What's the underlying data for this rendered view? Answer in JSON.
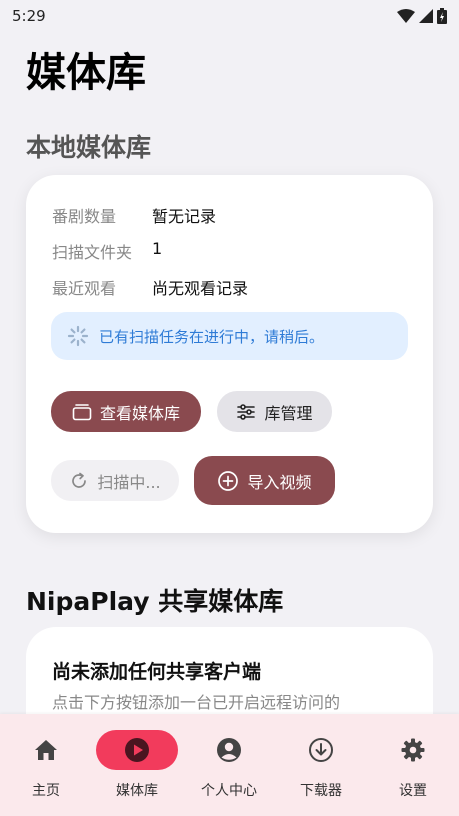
{
  "status_bar": {
    "time": "5:29"
  },
  "page_title": "媒体库",
  "local_section": {
    "title": "本地媒体库",
    "rows": [
      {
        "label": "番剧数量",
        "value": "暂无记录"
      },
      {
        "label": "扫描文件夹",
        "value": "1"
      },
      {
        "label": "最近观看",
        "value": "尚无观看记录"
      }
    ],
    "alert_text": "已有扫描任务在进行中，请稍后。",
    "buttons": {
      "view_library": "查看媒体库",
      "manage_library": "库管理",
      "scanning": "扫描中...",
      "import_video": "导入视频"
    }
  },
  "shared_section": {
    "title": "NipaPlay 共享媒体库",
    "empty_title": "尚未添加任何共享客户端",
    "empty_desc": "点击下方按钮添加一台已开启远程访问的"
  },
  "bottom_nav": {
    "items": [
      {
        "label": "主页",
        "icon": "home-icon"
      },
      {
        "label": "媒体库",
        "icon": "play-circle-icon",
        "active": true
      },
      {
        "label": "个人中心",
        "icon": "account-circle-icon"
      },
      {
        "label": "下载器",
        "icon": "download-circle-icon"
      },
      {
        "label": "设置",
        "icon": "gear-icon"
      }
    ]
  },
  "colors": {
    "primary_button": "#8a4a4f",
    "nav_active": "#f23b5c",
    "nav_background": "#fbe9ec",
    "alert_background": "#e2efff",
    "alert_text": "#2e7bd6"
  }
}
